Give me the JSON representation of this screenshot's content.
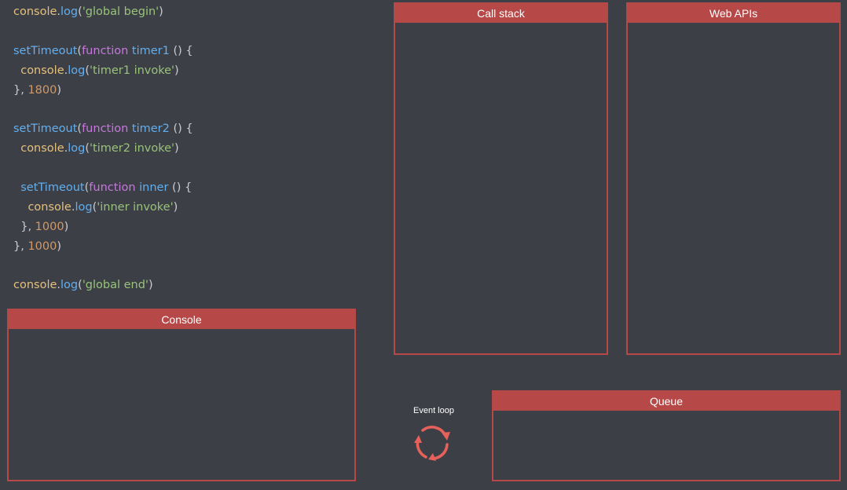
{
  "code": {
    "lines": [
      [
        [
          "obj",
          "console"
        ],
        [
          "pun",
          "."
        ],
        [
          "fn",
          "log"
        ],
        [
          "pun",
          "("
        ],
        [
          "str",
          "'global begin'"
        ],
        [
          "pun",
          ")"
        ]
      ],
      [],
      [
        [
          "fn",
          "setTimeout"
        ],
        [
          "pun",
          "("
        ],
        [
          "kw",
          "function"
        ],
        [
          "pun",
          " "
        ],
        [
          "fn",
          "timer1"
        ],
        [
          "pun",
          " () {"
        ]
      ],
      [
        [
          "pun",
          "  "
        ],
        [
          "obj",
          "console"
        ],
        [
          "pun",
          "."
        ],
        [
          "fn",
          "log"
        ],
        [
          "pun",
          "("
        ],
        [
          "str",
          "'timer1 invoke'"
        ],
        [
          "pun",
          ")"
        ]
      ],
      [
        [
          "pun",
          "}, "
        ],
        [
          "num",
          "1800"
        ],
        [
          "pun",
          ")"
        ]
      ],
      [],
      [
        [
          "fn",
          "setTimeout"
        ],
        [
          "pun",
          "("
        ],
        [
          "kw",
          "function"
        ],
        [
          "pun",
          " "
        ],
        [
          "fn",
          "timer2"
        ],
        [
          "pun",
          " () {"
        ]
      ],
      [
        [
          "pun",
          "  "
        ],
        [
          "obj",
          "console"
        ],
        [
          "pun",
          "."
        ],
        [
          "fn",
          "log"
        ],
        [
          "pun",
          "("
        ],
        [
          "str",
          "'timer2 invoke'"
        ],
        [
          "pun",
          ")"
        ]
      ],
      [],
      [
        [
          "pun",
          "  "
        ],
        [
          "fn",
          "setTimeout"
        ],
        [
          "pun",
          "("
        ],
        [
          "kw",
          "function"
        ],
        [
          "pun",
          " "
        ],
        [
          "fn",
          "inner"
        ],
        [
          "pun",
          " () {"
        ]
      ],
      [
        [
          "pun",
          "    "
        ],
        [
          "obj",
          "console"
        ],
        [
          "pun",
          "."
        ],
        [
          "fn",
          "log"
        ],
        [
          "pun",
          "("
        ],
        [
          "str",
          "'inner invoke'"
        ],
        [
          "pun",
          ")"
        ]
      ],
      [
        [
          "pun",
          "  }, "
        ],
        [
          "num",
          "1000"
        ],
        [
          "pun",
          ")"
        ]
      ],
      [
        [
          "pun",
          "}, "
        ],
        [
          "num",
          "1000"
        ],
        [
          "pun",
          ")"
        ]
      ],
      [],
      [
        [
          "obj",
          "console"
        ],
        [
          "pun",
          "."
        ],
        [
          "fn",
          "log"
        ],
        [
          "pun",
          "("
        ],
        [
          "str",
          "'global end'"
        ],
        [
          "pun",
          ")"
        ]
      ]
    ]
  },
  "panels": {
    "console": {
      "title": "Console"
    },
    "call_stack": {
      "title": "Call stack"
    },
    "web_apis": {
      "title": "Web APIs"
    },
    "queue": {
      "title": "Queue"
    }
  },
  "event_loop": {
    "label": "Event loop",
    "icon": "refresh-cycle-icon"
  },
  "colors": {
    "background": "#3d3f47",
    "panel_accent": "#b64848",
    "event_loop_icon": "#e5615a",
    "syntax_object": "#e5c07b",
    "syntax_function": "#61afef",
    "syntax_keyword": "#c678dd",
    "syntax_string": "#98c379",
    "syntax_number": "#d19a66",
    "syntax_punctuation": "#c9cbd1"
  }
}
